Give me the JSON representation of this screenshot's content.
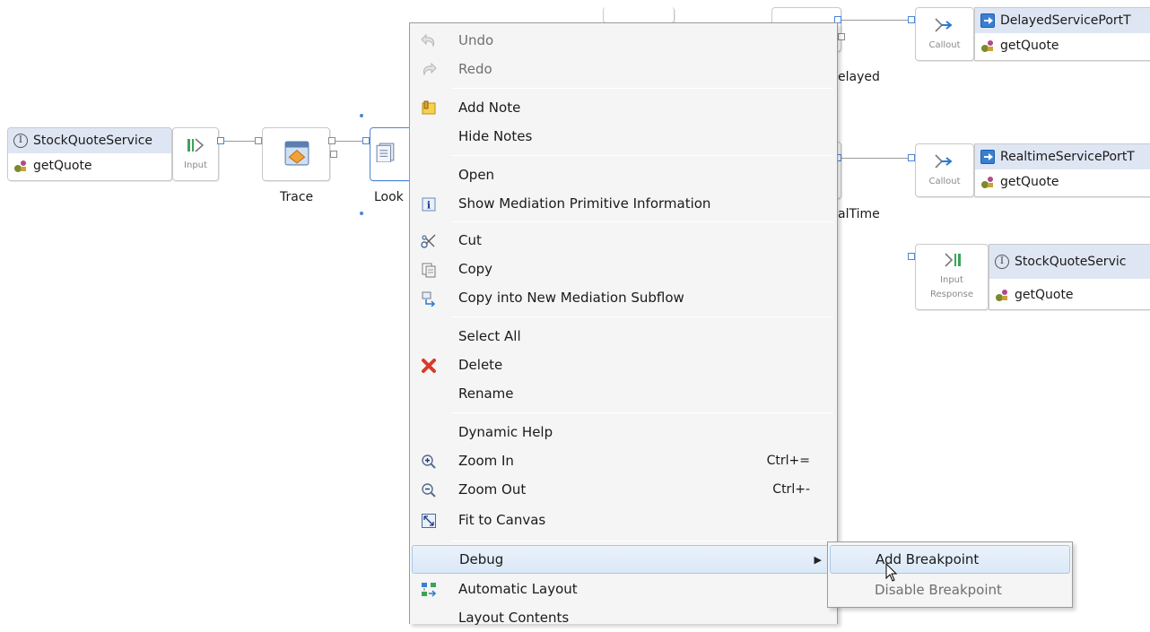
{
  "diagram": {
    "input_node": {
      "interface": "StockQuoteService",
      "operation": "getQuote",
      "kind_label": "Input"
    },
    "trace_label": "Trace",
    "lookup_label": "Look",
    "delayed_label": "elayed",
    "realtime_label": "alTime",
    "callout_delayed": {
      "kind_label": "Callout",
      "interface": "DelayedServicePortT",
      "operation": "getQuote"
    },
    "callout_realtime": {
      "kind_label": "Callout",
      "interface": "RealtimeServicePortT",
      "operation": "getQuote"
    },
    "input_response": {
      "kind_label_1": "Input",
      "kind_label_2": "Response",
      "interface": "StockQuoteServic",
      "operation": "getQuote"
    }
  },
  "context_menu": {
    "items": [
      {
        "label": "Undo",
        "icon": "undo-icon",
        "enabled": false
      },
      {
        "label": "Redo",
        "icon": "redo-icon",
        "enabled": false
      },
      {
        "label": "Add Note",
        "icon": "note-icon"
      },
      {
        "label": "Hide Notes"
      },
      {
        "label": "Open"
      },
      {
        "label": "Show Mediation Primitive Information",
        "icon": "info-icon"
      },
      {
        "label": "Cut",
        "icon": "scissors-icon"
      },
      {
        "label": "Copy",
        "icon": "copy-icon"
      },
      {
        "label": "Copy into New Mediation Subflow",
        "icon": "subflow-icon"
      },
      {
        "label": "Select All"
      },
      {
        "label": "Delete",
        "icon": "delete-icon"
      },
      {
        "label": "Rename"
      },
      {
        "label": "Dynamic Help"
      },
      {
        "label": "Zoom In",
        "shortcut": "Ctrl+=",
        "icon": "zoom-in-icon"
      },
      {
        "label": "Zoom Out",
        "shortcut": "Ctrl+-",
        "icon": "zoom-out-icon"
      },
      {
        "label": "Fit to Canvas",
        "icon": "fit-canvas-icon"
      },
      {
        "label": "Debug",
        "has_submenu": true
      },
      {
        "label": "Automatic Layout",
        "icon": "auto-layout-icon"
      },
      {
        "label": "Layout Contents"
      }
    ]
  },
  "debug_submenu": {
    "items": [
      {
        "label": "Add Breakpoint",
        "enabled": true
      },
      {
        "label": "Disable Breakpoint",
        "enabled": false
      }
    ]
  },
  "colors": {
    "interface_header": "#dfe6f3",
    "menu_bg": "#f5f5f5",
    "menu_highlight": "#dbe8f7",
    "delete_red": "#d83a2a"
  }
}
